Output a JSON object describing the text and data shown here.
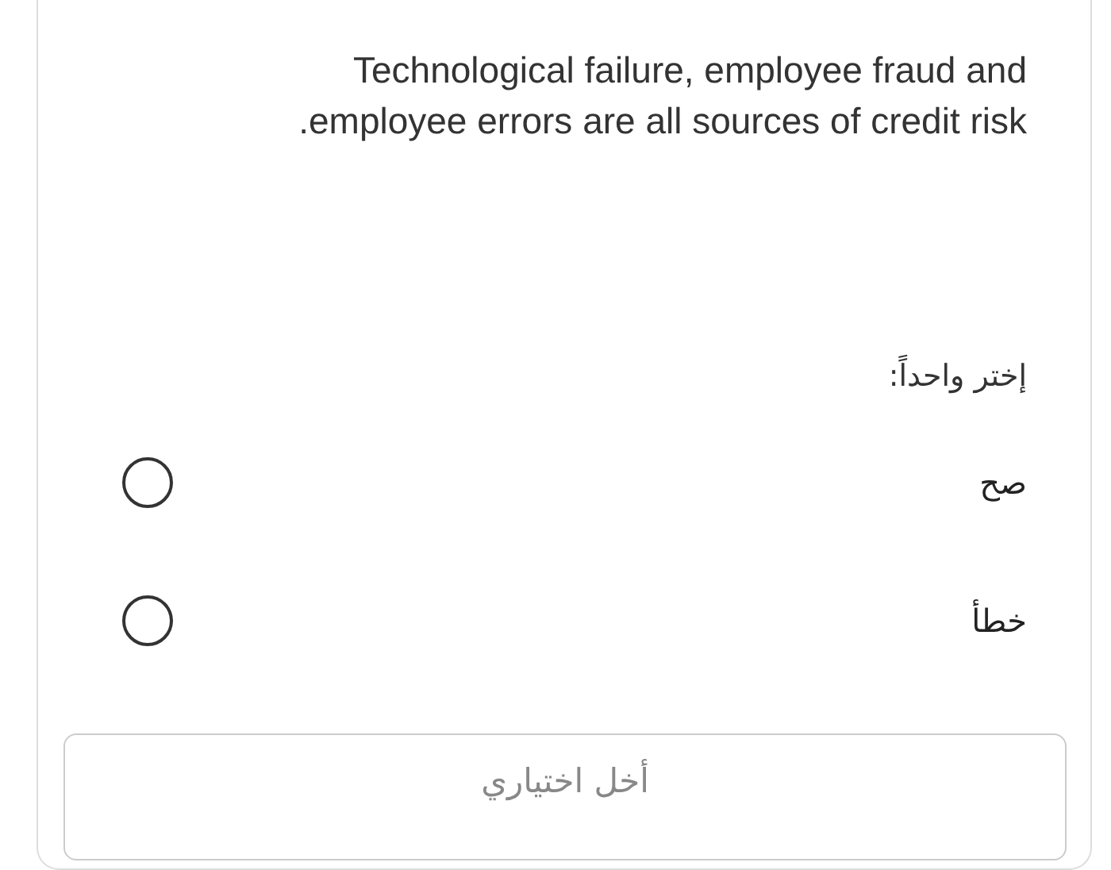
{
  "question": {
    "text": "Technological failure, employee fraud and employee errors are all sources of credit risk.",
    "prompt": "إختر واحداً:",
    "options": [
      {
        "label": "صح",
        "selected": false
      },
      {
        "label": "خطأ",
        "selected": false
      }
    ]
  },
  "clear_button": {
    "label": "أخل اختياري"
  }
}
